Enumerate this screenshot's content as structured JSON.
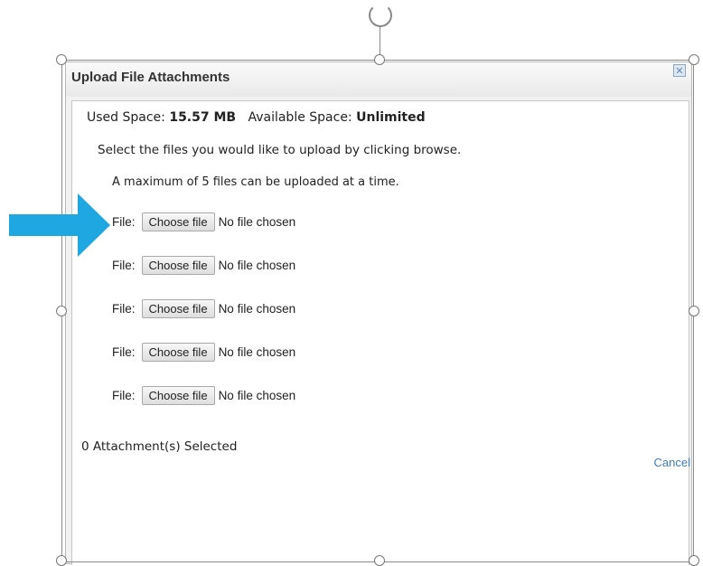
{
  "dialog": {
    "title": "Upload File Attachments",
    "close_icon": "close-icon"
  },
  "space": {
    "used_label": "Used Space:",
    "used_value": "15.57 MB",
    "available_label": "Available Space:",
    "available_value": "Unlimited"
  },
  "instructions": {
    "line1": "Select the files you would like to upload by clicking browse.",
    "line2": "A maximum of 5 files can be uploaded at a time."
  },
  "file_inputs": [
    {
      "label": "File:",
      "button": "Choose file",
      "status": "No file chosen"
    },
    {
      "label": "File:",
      "button": "Choose file",
      "status": "No file chosen"
    },
    {
      "label": "File:",
      "button": "Choose file",
      "status": "No file chosen"
    },
    {
      "label": "File:",
      "button": "Choose file",
      "status": "No file chosen"
    },
    {
      "label": "File:",
      "button": "Choose file",
      "status": "No file chosen"
    }
  ],
  "footer": {
    "attachments_selected": "0 Attachment(s) Selected",
    "cancel_label": "Cancel"
  },
  "colors": {
    "arrow": "#1ea7e1",
    "link": "#3b7bbf"
  }
}
